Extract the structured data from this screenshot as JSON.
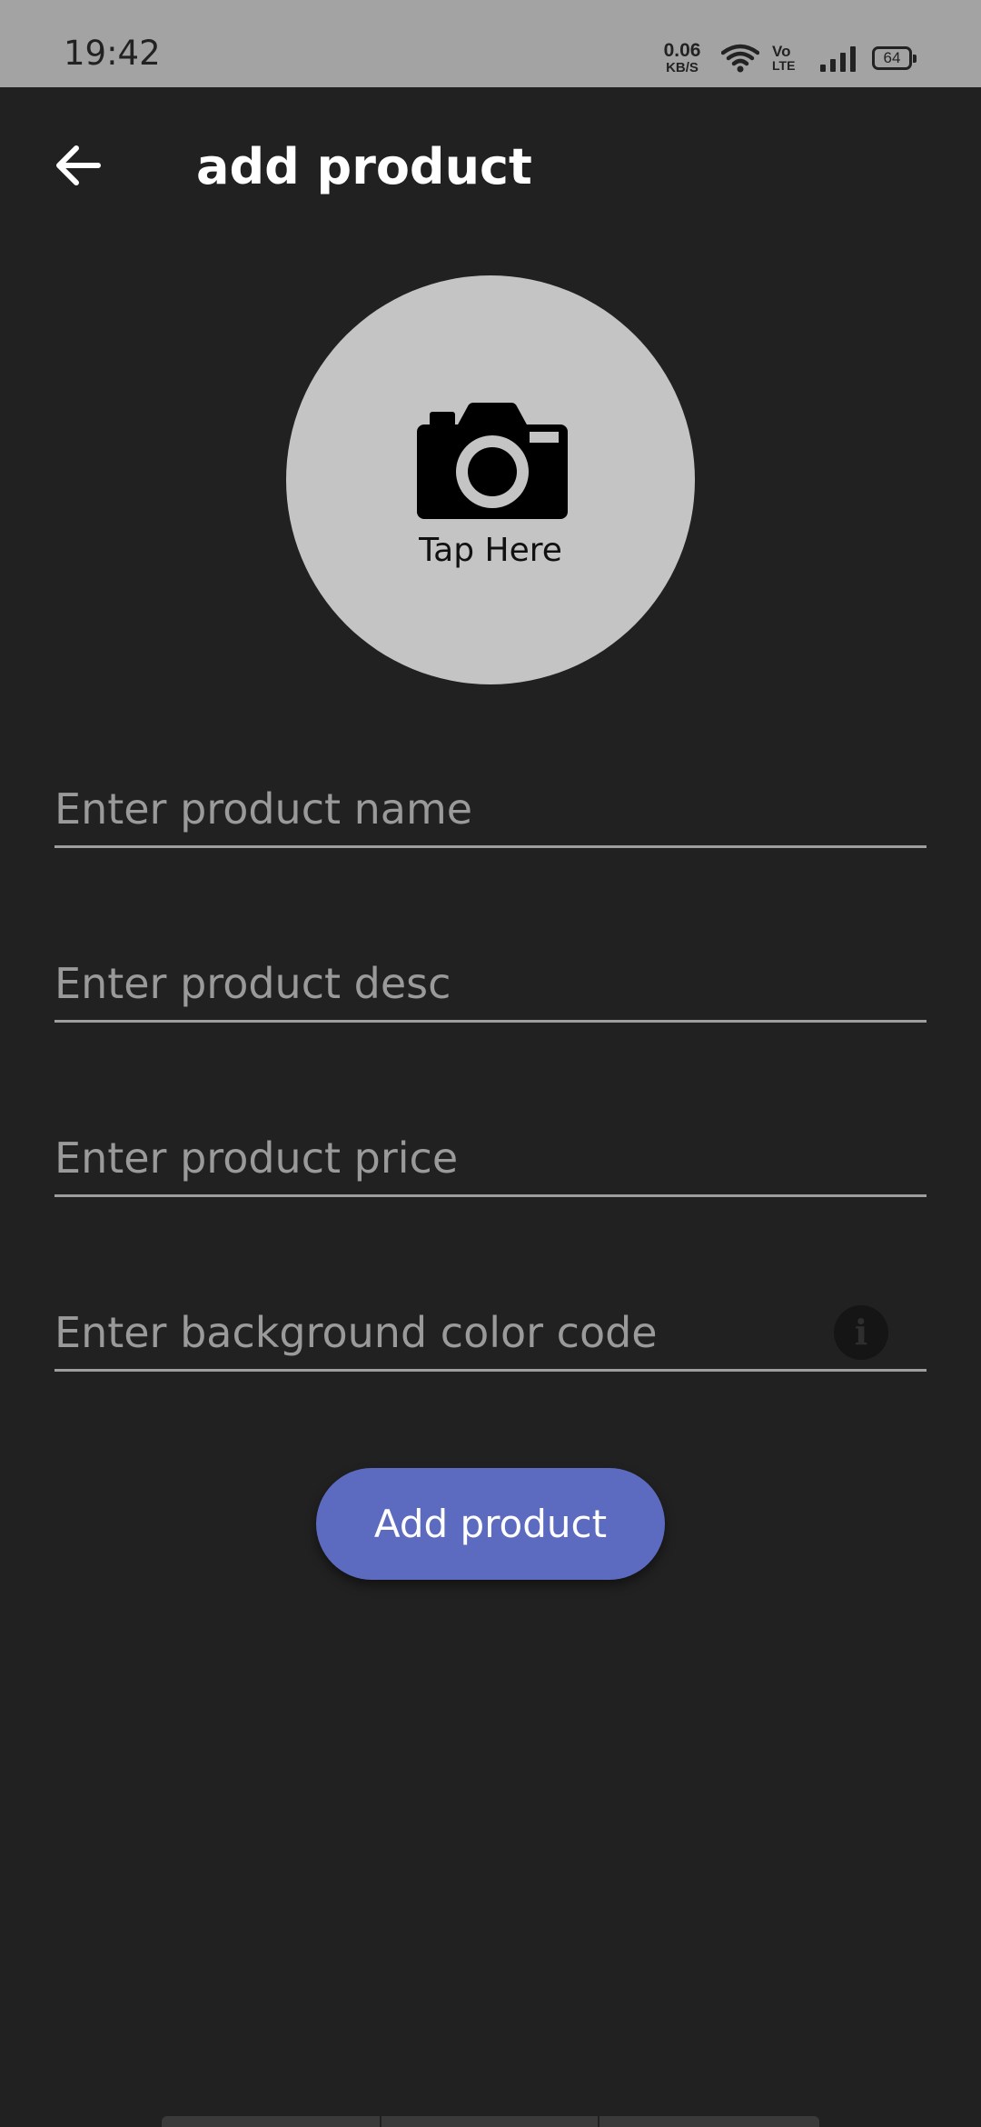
{
  "status_bar": {
    "time": "19:42",
    "net_speed_value": "0.06",
    "net_speed_unit": "KB/S",
    "volte_top": "Vo",
    "volte_bottom": "LTE",
    "battery_level": "64",
    "icons": [
      "wifi-icon",
      "volte-icon",
      "signal-icon",
      "battery-icon"
    ]
  },
  "app_bar": {
    "back_icon": "arrow-left-icon",
    "title": "add product"
  },
  "image_picker": {
    "icon": "camera-icon",
    "label": "Tap Here"
  },
  "form": {
    "fields": [
      {
        "placeholder": "Enter product name",
        "value": ""
      },
      {
        "placeholder": "Enter product desc",
        "value": ""
      },
      {
        "placeholder": "Enter product price",
        "value": ""
      },
      {
        "placeholder": "Enter background color code",
        "value": ""
      }
    ],
    "info_icon": "info-icon",
    "submit_label": "Add product"
  },
  "colors": {
    "background": "#212121",
    "status_bar": "#a3a3a3",
    "accent": "#5c6bc0",
    "picker_circle": "#c4c4c4",
    "field_underline": "#9e9e9e",
    "placeholder": "#9a9a9a"
  }
}
